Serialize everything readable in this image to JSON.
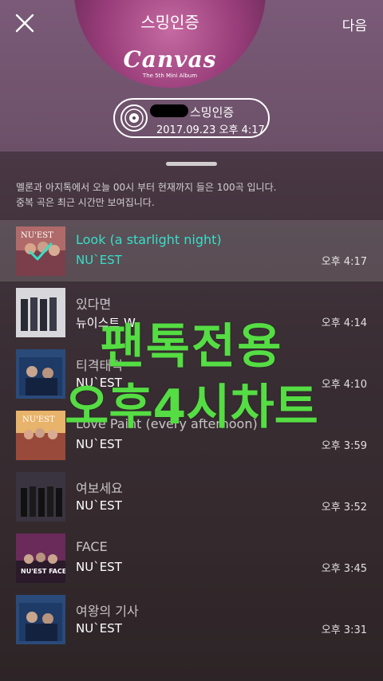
{
  "header": {
    "cover_caption": "스밍인증",
    "album_title": "Canvas",
    "album_subtitle": "The 5th Mini Album",
    "next_label": "다음"
  },
  "certificate": {
    "label": "스밍인증",
    "datetime": "2017.09.23 오후 4:17"
  },
  "notice": {
    "line1": "멜론과 아지톡에서 오늘 00시 부터 현재까지 들은 100곡 입니다.",
    "line2": "중복 곡은 최근 시간만 보여집니다."
  },
  "songs": [
    {
      "title": "Look (a starlight night)",
      "artist": "NU`EST",
      "time": "오후 4:17",
      "selected": true
    },
    {
      "title": "있다면",
      "artist": "뉴이스트 W",
      "time": "오후 4:14"
    },
    {
      "title": "티격태격",
      "artist": "NU`EST",
      "time": "오후 4:10"
    },
    {
      "title": "Love Paint (every afternoon)",
      "artist": "NU`EST",
      "time": "오후 3:59"
    },
    {
      "title": "여보세요",
      "artist": "NU`EST",
      "time": "오후 3:52"
    },
    {
      "title": "FACE",
      "artist": "NU`EST",
      "time": "오후 3:45"
    },
    {
      "title": "여왕의 기사",
      "artist": "NU`EST",
      "time": "오후 3:31"
    }
  ],
  "watermark": {
    "line1": "팬톡전용",
    "line2": "오후4시차트"
  },
  "colors": {
    "accent": "#35e0c8",
    "watermark": "#55dd44"
  },
  "icons": {
    "close": "close-icon",
    "disc": "disc-icon",
    "check": "check-icon"
  }
}
